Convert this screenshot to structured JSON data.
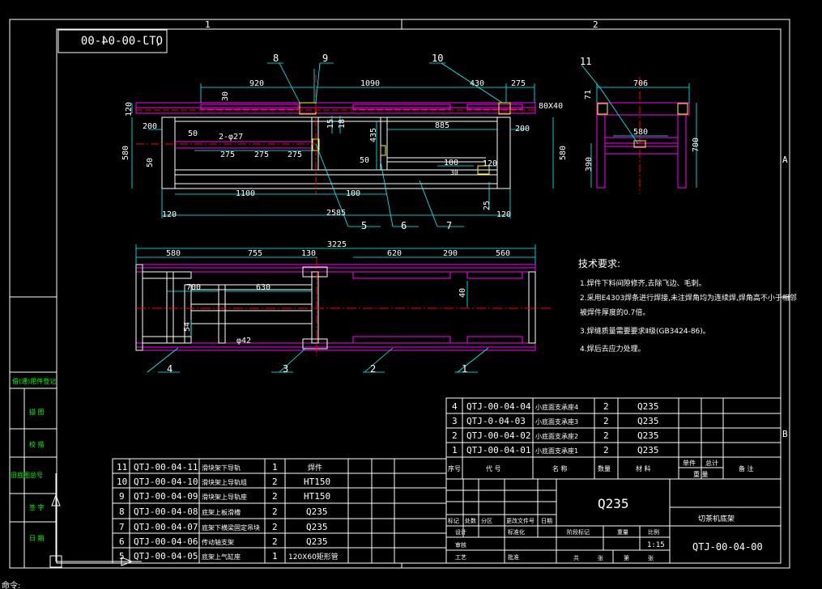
{
  "colors": {
    "background": "#000000",
    "border": "#ffffff",
    "dimension": "#00ffff",
    "frame": "#ff00ff",
    "text": "#ffffff",
    "note": "#ffffff",
    "center": "#ff0000",
    "yellow": "#ffff00",
    "green": "#00ff00"
  },
  "sheet": {
    "zone_top": [
      "1",
      "2"
    ],
    "zone_right": [
      "A",
      "B"
    ],
    "drawing_no_stamp": "QTJ-00-04-00"
  },
  "front_view": {
    "dims": {
      "d920": "920",
      "d1090": "1090",
      "d430": "430",
      "d275a": "275",
      "d80x40": "80X40",
      "d120a": "120",
      "d30": "30",
      "d200a": "200",
      "d50a": "50",
      "phi27": "2-φ27",
      "d15": "15",
      "d18": "18",
      "d435": "435",
      "d885": "885",
      "d200b": "200",
      "d580a": "580",
      "d580b": "580",
      "d50b": "50",
      "d275b": "275",
      "d275c": "275",
      "d275d": "275",
      "d50c": "50",
      "d100a": "100",
      "d120b": "120",
      "d30b": "30",
      "d1100": "1100",
      "d100b": "100",
      "d25": "25",
      "d120c": "120",
      "d2585": "2585",
      "d120d": "120"
    },
    "balloons": [
      "8",
      "9",
      "10",
      "5",
      "6",
      "7"
    ]
  },
  "side_view": {
    "dims": {
      "d706": "706",
      "d71": "71",
      "d580": "580",
      "d700": "700",
      "d390": "390"
    },
    "balloons": [
      "11"
    ]
  },
  "top_view": {
    "dims": {
      "d3225": "3225",
      "d580": "580",
      "d755": "755",
      "d130": "130",
      "d620": "620",
      "d290": "290",
      "d560": "560",
      "d700": "700",
      "d630": "630",
      "d40": "40",
      "d54": "54",
      "phi42": "φ42"
    },
    "balloons": [
      "4",
      "3",
      "2",
      "1"
    ]
  },
  "notes": {
    "title": "技术要求:",
    "items": [
      "1.焊件下料间隙修齐,去除飞边、毛刺。",
      "2.采用E4303焊条进行焊接,未注焊角均为连续焊,焊角高不小于相邻",
      "被焊件厚度的0.7倍。",
      "3.焊缝质量需要要求Ⅱ级(GB3424-86)。",
      "4.焊后去应力处理。"
    ]
  },
  "left_strip": [
    "借(通)用件登记",
    "描 图",
    "校 描",
    "旧底图总号",
    "签 字",
    "日 期"
  ],
  "bom_right": {
    "rows": [
      {
        "no": "4",
        "code": "QTJ-00-04-04",
        "name": "小底面支承座4",
        "qty": "2",
        "mat": "Q235"
      },
      {
        "no": "3",
        "code": "QTJ-0-04-03",
        "name": "小底面支承座3",
        "qty": "2",
        "mat": "Q235"
      },
      {
        "no": "2",
        "code": "QTJ-00-04-02",
        "name": "小底面支承座2",
        "qty": "2",
        "mat": "Q235"
      },
      {
        "no": "1",
        "code": "QTJ-00-04-01",
        "name": "小底面支承座1",
        "qty": "2",
        "mat": "Q235"
      }
    ],
    "header": [
      "序号",
      "代 号",
      "名 称",
      "数量",
      "材 料",
      "单件",
      "总计",
      "备 注"
    ],
    "header_sub": "重 量"
  },
  "bom_left": {
    "rows": [
      {
        "no": "11",
        "code": "QTJ-00-04-11",
        "name": "滑块架下导轨",
        "qty": "1",
        "mat": "焊件"
      },
      {
        "no": "10",
        "code": "QTJ-00-04-10",
        "name": "滑块架上导轨组",
        "qty": "2",
        "mat": "HT150"
      },
      {
        "no": "9",
        "code": "QTJ-00-04-09",
        "name": "滑块架上导轨座",
        "qty": "2",
        "mat": "HT150"
      },
      {
        "no": "8",
        "code": "QTJ-00-04-08",
        "name": "底架上板滑槽",
        "qty": "2",
        "mat": "Q235"
      },
      {
        "no": "7",
        "code": "QTJ-00-04-07",
        "name": "底架下横梁固定吊块",
        "qty": "2",
        "mat": "Q235"
      },
      {
        "no": "6",
        "code": "QTJ-00-04-06",
        "name": "传动轴支架",
        "qty": "2",
        "mat": "Q235"
      },
      {
        "no": "5",
        "code": "QTJ-00-04-05",
        "name": "底架上气缸座",
        "qty": "1",
        "mat": "120X60矩形管"
      }
    ]
  },
  "title_block": {
    "material": "Q235",
    "part_name": "切茶机底架",
    "drawing_no": "QTJ-00-04-00",
    "scale": "1:15",
    "labels": {
      "mark": "标记",
      "count": "处数",
      "zone": "分区",
      "change_doc": "更改文件号",
      "sign": "签名",
      "date": "日期",
      "design": "设计",
      "std": "标准化",
      "stage_mark": "阶段标记",
      "weight": "重量",
      "ratio": "比例",
      "review": "审核",
      "process": "工艺",
      "approve": "批准",
      "total": "共",
      "sheet": "张",
      "page": "第",
      "page2": "张"
    }
  },
  "command_prompt": "命令:"
}
